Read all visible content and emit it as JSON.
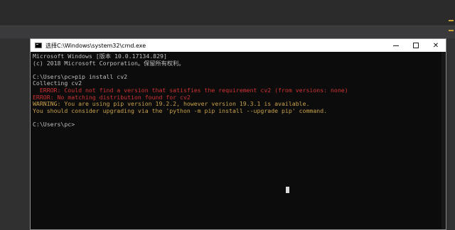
{
  "window": {
    "title": "选择C:\\Windows\\system32\\cmd.exe",
    "controls": {
      "minimize": "—",
      "maximize": "",
      "close": "✕"
    }
  },
  "console": {
    "lines": [
      {
        "text": "Microsoft Windows [版本 10.0.17134.829]",
        "kind": "normal"
      },
      {
        "text": "(c) 2018 Microsoft Corporation。保留所有权利。",
        "kind": "normal"
      },
      {
        "text": "",
        "kind": "normal"
      },
      {
        "text": "C:\\Users\\pc>pip install cv2",
        "kind": "normal"
      },
      {
        "text": "Collecting cv2",
        "kind": "normal"
      },
      {
        "text": "  ERROR: Could not find a version that satisfies the requirement cv2 (from versions: none)",
        "kind": "error"
      },
      {
        "text": "ERROR: No matching distribution found for cv2",
        "kind": "error"
      },
      {
        "text": "WARNING: You are using pip version 19.2.2, however version 19.3.1 is available.",
        "kind": "warn"
      },
      {
        "text": "You should consider upgrading via the 'python -m pip install --upgrade pip' command.",
        "kind": "warn"
      },
      {
        "text": "",
        "kind": "normal"
      },
      {
        "text": "C:\\Users\\pc>",
        "kind": "normal"
      }
    ]
  },
  "colors": {
    "error": "#d13232",
    "warning": "#c8a14a",
    "text": "#c0c0c0",
    "background": "#0c0c0c"
  }
}
